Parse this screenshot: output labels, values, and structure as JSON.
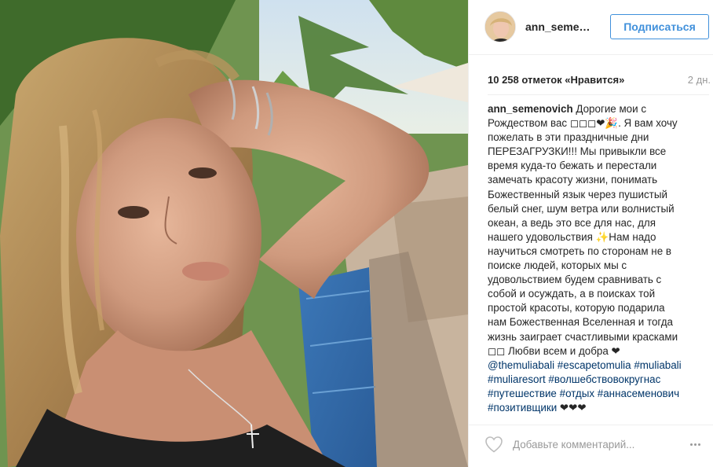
{
  "post": {
    "author": "ann_semenovich",
    "header_username": "ann_seme…",
    "follow_label": "Подписаться",
    "likes": "10 258 отметок «Нравится»",
    "time_ago": "2 дн.",
    "caption_lines": [
      {
        "bold": "ann_semenovich",
        "text": " Дорогие мои с"
      },
      {
        "text": "Рождеством вас ◻◻◻❤🎉. Я вам хочу"
      },
      {
        "text": "пожелать в эти праздничные дни"
      },
      {
        "text": "ПЕРЕЗАГРУЗКИ!!! Мы привыкли все"
      },
      {
        "text": "время куда-то бежать и перестали"
      },
      {
        "text": "замечать красоту жизни, понимать"
      },
      {
        "text": "Божественный язык через пушистый"
      },
      {
        "text": "белый снег, шум ветра или волнистый"
      },
      {
        "text": "океан, а ведь это все для нас, для"
      },
      {
        "text": "нашего удовольствия ✨Нам надо"
      },
      {
        "text": "научиться смотреть по сторонам не в"
      },
      {
        "text": "поиске людей, которых мы с"
      },
      {
        "text": "удовольствием будем сравнивать с"
      },
      {
        "text": "собой и осуждать, а в поисках той"
      },
      {
        "text": "простой красоты, которую подарила"
      },
      {
        "text": "нам Божественная Вселенная и тогда"
      },
      {
        "text": "жизнь заиграет счастливыми красками"
      },
      {
        "text": "◻◻ Любви всем и добра ❤"
      }
    ],
    "hashtag_lines": [
      [
        "@themuliabali",
        "#escapetomulia",
        "#muliabali"
      ],
      [
        "#muliaresort",
        "#волшебствовокругнас"
      ],
      [
        "#путешествие",
        "#отдых",
        "#аннасеменович"
      ],
      [
        "#позитивщики"
      ]
    ],
    "hearts_suffix": "❤❤❤",
    "comment_placeholder": "Добавьте комментарий..."
  },
  "icons": {
    "like": "heart-outline-icon",
    "more": "more-horizontal-icon",
    "avatar": "profile-avatar"
  },
  "colors": {
    "accent": "#4090db",
    "link": "#003569",
    "muted": "#999999"
  }
}
